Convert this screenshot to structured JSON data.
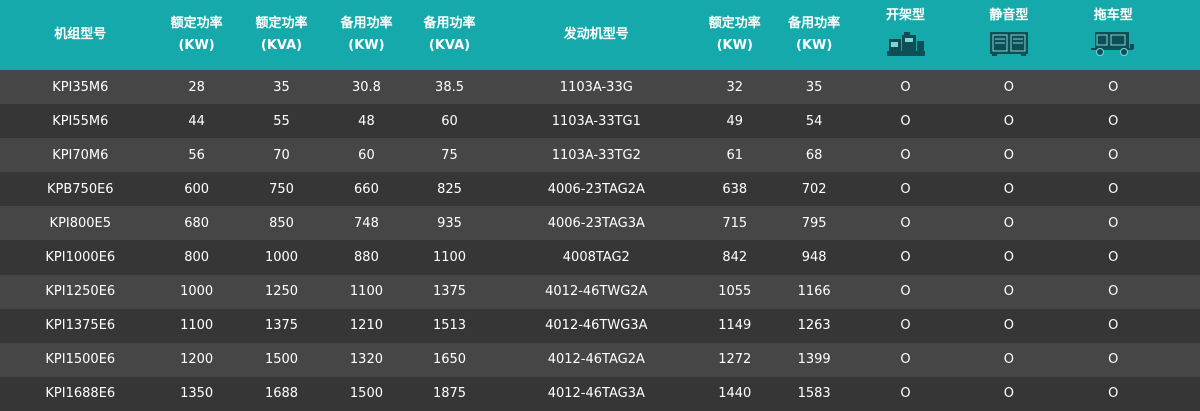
{
  "header": {
    "columns": [
      {
        "label": "机组型号",
        "sub": ""
      },
      {
        "label": "额定功率",
        "sub": "(KW)"
      },
      {
        "label": "额定功率",
        "sub": "(KVA)"
      },
      {
        "label": "备用功率",
        "sub": "(KW)"
      },
      {
        "label": "备用功率",
        "sub": "(KVA)"
      },
      {
        "label": "发动机型号",
        "sub": ""
      },
      {
        "label": "额定功率",
        "sub": "(KW)"
      },
      {
        "label": "备用功率",
        "sub": "(KW)"
      },
      {
        "label": "开架型",
        "icon": "open-frame-generator-icon"
      },
      {
        "label": "静音型",
        "icon": "silent-generator-icon"
      },
      {
        "label": "拖车型",
        "icon": "trailer-generator-icon"
      }
    ]
  },
  "colors": {
    "header_bg": "#15a9ab",
    "row_odd": "#464646",
    "row_even": "#363636",
    "text": "#ffffff"
  },
  "rows": [
    [
      "KPI35M6",
      "28",
      "35",
      "30.8",
      "38.5",
      "1103A-33G",
      "32",
      "35",
      "O",
      "O",
      "O"
    ],
    [
      "KPI55M6",
      "44",
      "55",
      "48",
      "60",
      "1103A-33TG1",
      "49",
      "54",
      "O",
      "O",
      "O"
    ],
    [
      "KPI70M6",
      "56",
      "70",
      "60",
      "75",
      "1103A-33TG2",
      "61",
      "68",
      "O",
      "O",
      "O"
    ],
    [
      "KPB750E6",
      "600",
      "750",
      "660",
      "825",
      "4006-23TAG2A",
      "638",
      "702",
      "O",
      "O",
      "O"
    ],
    [
      "KPI800E5",
      "680",
      "850",
      "748",
      "935",
      "4006-23TAG3A",
      "715",
      "795",
      "O",
      "O",
      "O"
    ],
    [
      "KPI1000E6",
      "800",
      "1000",
      "880",
      "1100",
      "4008TAG2",
      "842",
      "948",
      "O",
      "O",
      "O"
    ],
    [
      "KPI1250E6",
      "1000",
      "1250",
      "1100",
      "1375",
      "4012-46TWG2A",
      "1055",
      "1166",
      "O",
      "O",
      "O"
    ],
    [
      "KPI1375E6",
      "1100",
      "1375",
      "1210",
      "1513",
      "4012-46TWG3A",
      "1149",
      "1263",
      "O",
      "O",
      "O"
    ],
    [
      "KPI1500E6",
      "1200",
      "1500",
      "1320",
      "1650",
      "4012-46TAG2A",
      "1272",
      "1399",
      "O",
      "O",
      "O"
    ],
    [
      "KPI1688E6",
      "1350",
      "1688",
      "1500",
      "1875",
      "4012-46TAG3A",
      "1440",
      "1583",
      "O",
      "O",
      "O"
    ]
  ]
}
